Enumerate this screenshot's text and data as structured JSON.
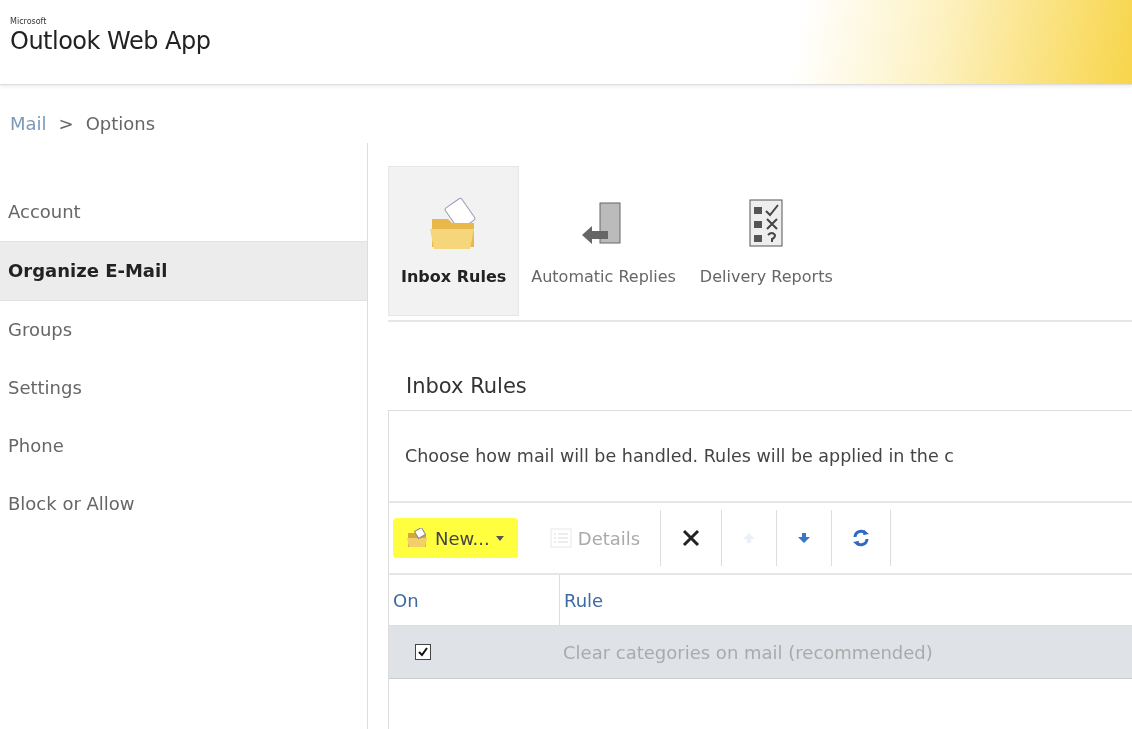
{
  "header": {
    "brand_small": "Microsoft",
    "brand": "Outlook Web App"
  },
  "breadcrumb": [
    {
      "label": "Mail",
      "link": true
    },
    {
      "label": ">",
      "link": false
    },
    {
      "label": "Options",
      "link": false
    }
  ],
  "sidebar": {
    "items": [
      {
        "label": "Account",
        "selected": false
      },
      {
        "label": "Organize E-Mail",
        "selected": true
      },
      {
        "label": "Groups",
        "selected": false
      },
      {
        "label": "Settings",
        "selected": false
      },
      {
        "label": "Phone",
        "selected": false
      },
      {
        "label": "Block or Allow",
        "selected": false
      }
    ]
  },
  "tabs": [
    {
      "label": "Inbox Rules",
      "kind": "folder",
      "selected": true
    },
    {
      "label": "Automatic Replies",
      "kind": "door",
      "selected": false
    },
    {
      "label": "Delivery Reports",
      "kind": "checklist",
      "selected": false
    }
  ],
  "section": {
    "title": "Inbox Rules",
    "description": "Choose how mail will be handled. Rules will be applied in the c"
  },
  "toolbar": [
    {
      "kind": "new",
      "label": "New...",
      "disabled": false,
      "highlighted": true
    },
    {
      "kind": "details",
      "label": "Details",
      "disabled": true,
      "highlighted": false
    },
    {
      "kind": "delete",
      "disabled": false,
      "highlighted": false
    },
    {
      "kind": "up",
      "disabled": true,
      "highlighted": false
    },
    {
      "kind": "down",
      "disabled": false,
      "highlighted": false
    },
    {
      "kind": "refresh",
      "disabled": false,
      "highlighted": false
    }
  ],
  "table": {
    "columns": [
      "On",
      "Rule"
    ],
    "rows": [
      {
        "on": true,
        "rule": "Clear categories on mail (recommended)",
        "selected": true
      }
    ]
  }
}
